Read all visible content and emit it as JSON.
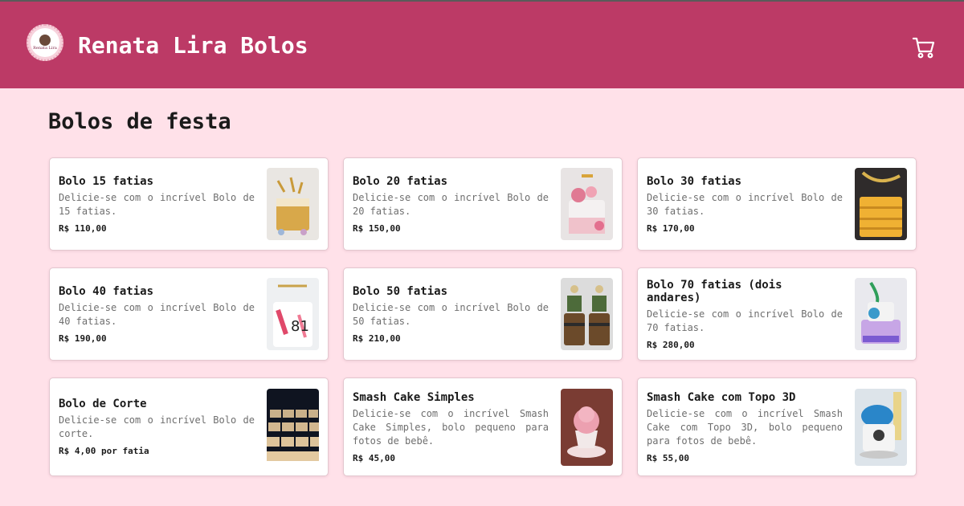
{
  "header": {
    "brand": "Renata Lira Bolos",
    "logo_text": "Renata Lira",
    "cart_icon": "shopping-cart-icon"
  },
  "section": {
    "title": "Bolos de festa"
  },
  "colors": {
    "header_bg": "#bc3a66",
    "page_bg": "#ffe1e9",
    "card_bg": "#ffffff"
  },
  "products": [
    {
      "title": "Bolo 15 fatias",
      "desc": "Delicie-se com o incrível Bolo de 15 fatias.",
      "price": "R$ 110,00",
      "image": "gold-drip-cake-photo"
    },
    {
      "title": "Bolo 20 fatias",
      "desc": "Delicie-se com o incrível Bolo de 20 fatias.",
      "price": "R$ 150,00",
      "image": "pink-flower-cake-photo"
    },
    {
      "title": "Bolo 30 fatias",
      "desc": "Delicie-se com o incrível Bolo de 30 fatias.",
      "price": "R$ 170,00",
      "image": "gold-striped-cake-photo"
    },
    {
      "title": "Bolo 40 fatias",
      "desc": "Delicie-se com o incrível Bolo de 40 fatias.",
      "price": "R$ 190,00",
      "image": "white-pink-cake-photo"
    },
    {
      "title": "Bolo 50 fatias",
      "desc": "Delicie-se com o incrível Bolo de 50 fatias.",
      "price": "R$ 210,00",
      "image": "barrel-cakes-photo"
    },
    {
      "title": "Bolo 70 fatias (dois andares)",
      "desc": "Delicie-se com o incrível Bolo de 70 fatias.",
      "price": "R$ 280,00",
      "image": "two-tier-cake-photo"
    },
    {
      "title": "Bolo de Corte",
      "desc": "Delicie-se com o incrível Bolo de corte.",
      "price": "R$ 4,00 por fatia",
      "image": "sliced-cake-trays-photo"
    },
    {
      "title": "Smash Cake Simples",
      "desc": "Delicie-se com o incrível Smash Cake Simples, bolo pequeno para fotos de bebê.",
      "price": "R$ 45,00",
      "image": "cupcake-smash-photo"
    },
    {
      "title": "Smash Cake com Topo 3D",
      "desc": "Delicie-se com o incrível Smash Cake com Topo 3D, bolo pequeno para fotos de bebê.",
      "price": "R$ 55,00",
      "image": "blue-topper-cake-photo"
    }
  ]
}
